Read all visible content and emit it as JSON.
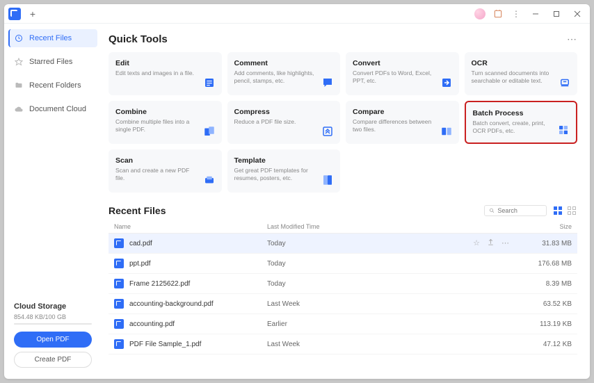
{
  "titlebar": {
    "plus": "+"
  },
  "sidebar": {
    "items": [
      {
        "label": "Recent Files",
        "icon": "clock"
      },
      {
        "label": "Starred Files",
        "icon": "star"
      },
      {
        "label": "Recent Folders",
        "icon": "folder"
      },
      {
        "label": "Document Cloud",
        "icon": "cloud"
      }
    ],
    "cloud": {
      "title": "Cloud Storage",
      "usage": "854.48 KB/100 GB",
      "open_pdf": "Open PDF",
      "create_pdf": "Create PDF"
    }
  },
  "quick_tools": {
    "title": "Quick Tools",
    "cards": [
      {
        "title": "Edit",
        "desc": "Edit texts and images in a file."
      },
      {
        "title": "Comment",
        "desc": "Add comments, like highlights, pencil, stamps, etc."
      },
      {
        "title": "Convert",
        "desc": "Convert PDFs to Word, Excel, PPT, etc."
      },
      {
        "title": "OCR",
        "desc": "Turn scanned documents into searchable or editable text."
      },
      {
        "title": "Combine",
        "desc": "Combine multiple files into a single PDF."
      },
      {
        "title": "Compress",
        "desc": "Reduce a PDF file size."
      },
      {
        "title": "Compare",
        "desc": "Compare differences between two files."
      },
      {
        "title": "Batch Process",
        "desc": "Batch convert, create, print, OCR PDFs, etc.",
        "highlight": true
      },
      {
        "title": "Scan",
        "desc": "Scan and create a new PDF file."
      },
      {
        "title": "Template",
        "desc": "Get great PDF templates for resumes, posters, etc."
      }
    ]
  },
  "recent": {
    "title": "Recent Files",
    "search_placeholder": "Search",
    "columns": {
      "name": "Name",
      "modified": "Last Modified Time",
      "size": "Size"
    },
    "files": [
      {
        "name": "cad.pdf",
        "modified": "Today",
        "size": "31.83 MB",
        "selected": true
      },
      {
        "name": "ppt.pdf",
        "modified": "Today",
        "size": "176.68 MB"
      },
      {
        "name": "Frame 2125622.pdf",
        "modified": "Today",
        "size": "8.39 MB"
      },
      {
        "name": "accounting-background.pdf",
        "modified": "Last Week",
        "size": "63.52 KB"
      },
      {
        "name": "accounting.pdf",
        "modified": "Earlier",
        "size": "113.19 KB"
      },
      {
        "name": "PDF File Sample_1.pdf",
        "modified": "Last Week",
        "size": "47.12 KB"
      }
    ]
  }
}
